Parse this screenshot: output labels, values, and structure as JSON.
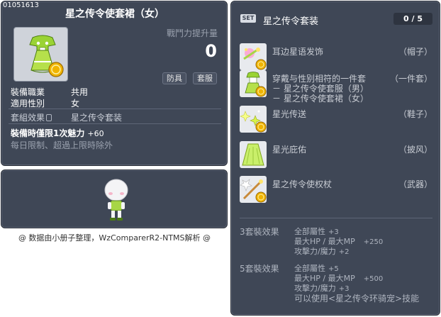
{
  "item": {
    "id": "01051613",
    "name": "星之传令使套裙（女）",
    "icon": "green-dress-item-icon",
    "power_label": "戰鬥力提升量",
    "power_value": "0",
    "category_buttons": [
      "防具",
      "套服"
    ],
    "job_label": "裝備職業",
    "job_value": "共用",
    "gender_label": "適用性別",
    "gender_value": "女",
    "set_label": "套組效果",
    "set_value": "星之传令套装",
    "equip_limit_label": "裝備時僅限1次魅力",
    "equip_limit_value": "+60",
    "daily_limit": "每日限制、超過上限時除外"
  },
  "avatar": {
    "icon": "character-preview"
  },
  "credit": "@ 数据由小册子整理，WzComparerR2-NTMS解析 @",
  "set": {
    "badge": "SET",
    "title": "星之传令套装",
    "count": "0 / 5",
    "items": [
      {
        "name": "耳边星语发饰",
        "type": "（帽子）",
        "icon": "hair-accessory-icon",
        "sub": []
      },
      {
        "name": "穿戴与性别相符的一件套",
        "type": "（一件套）",
        "icon": "outfit-icon",
        "sub": [
          "－ 星之传令使套服（男）",
          "－ 星之传令使套裙（女）"
        ]
      },
      {
        "name": "星光传送",
        "type": "（鞋子）",
        "icon": "sparkle-shoes-icon",
        "sub": []
      },
      {
        "name": "星光庇佑",
        "type": "（披风）",
        "icon": "cape-icon",
        "sub": []
      },
      {
        "name": "星之传令使权杖",
        "type": "（武器）",
        "icon": "scepter-icon",
        "sub": []
      }
    ],
    "effects": [
      {
        "label": "3套裝效果",
        "lines": [
          {
            "text": "全部屬性",
            "value": "+3"
          },
          {
            "text": "最大HP / 最大MP",
            "value": "+250"
          },
          {
            "text": "攻擊力/魔力",
            "value": "+2"
          }
        ]
      },
      {
        "label": "5套裝效果",
        "lines": [
          {
            "text": "全部屬性",
            "value": "+5"
          },
          {
            "text": "最大HP / 最大MP",
            "value": "+500"
          },
          {
            "text": "攻擊力/魔力",
            "value": "+3"
          },
          {
            "text": "可以使用<星之传令环骑宠>技能",
            "value": ""
          }
        ]
      }
    ]
  },
  "colors": {
    "panel": "#3f4756",
    "text": "#ffffff",
    "muted": "#9aa1ae",
    "coin": "#f0b400"
  }
}
